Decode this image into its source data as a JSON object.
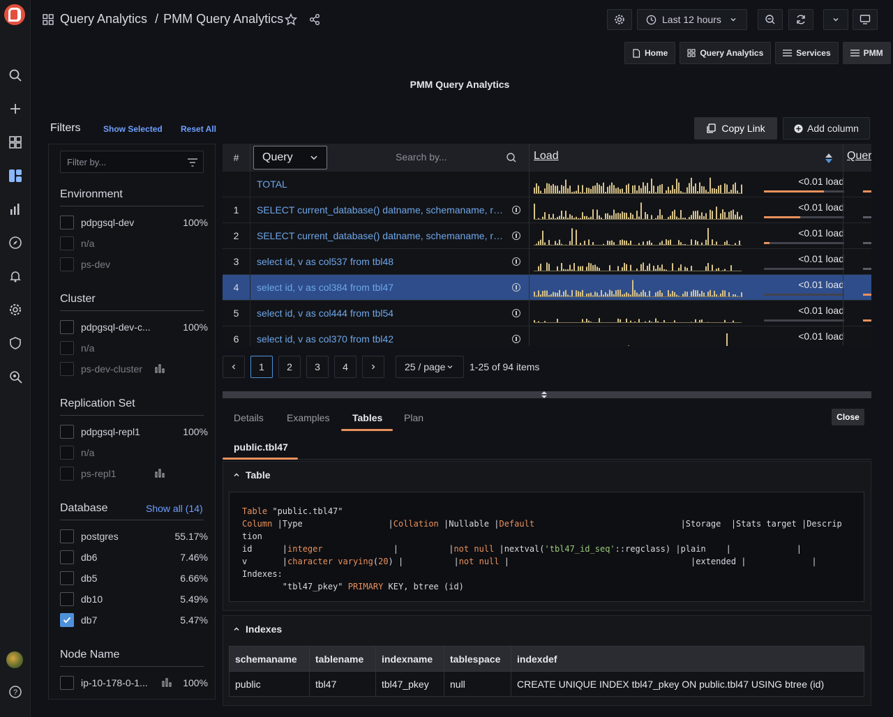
{
  "header": {
    "breadcrumb_root": "Query Analytics",
    "breadcrumb_sep": "/",
    "breadcrumb_page": "PMM Query Analytics",
    "time_range": "Last 12 hours"
  },
  "links": [
    "Home",
    "Query Analytics",
    "Services",
    "PMM"
  ],
  "panel_title": "PMM Query Analytics",
  "filters": {
    "title": "Filters",
    "show_selected": "Show Selected",
    "reset_all": "Reset All",
    "search_placeholder": "Filter by...",
    "show_all": "Show all (14)",
    "groups": [
      {
        "title": "Environment",
        "items": [
          {
            "label": "pdpgsql-dev",
            "pct": "100%",
            "checked": false,
            "dim": false
          },
          {
            "label": "n/a",
            "pct": "",
            "checked": false,
            "dim": true
          },
          {
            "label": "ps-dev",
            "pct": "",
            "checked": false,
            "dim": true
          }
        ]
      },
      {
        "title": "Cluster",
        "items": [
          {
            "label": "pdpgsql-dev-c...",
            "pct": "100%",
            "checked": false,
            "dim": false
          },
          {
            "label": "n/a",
            "pct": "",
            "checked": false,
            "dim": true
          },
          {
            "label": "ps-dev-cluster",
            "pct": "",
            "checked": false,
            "dim": true
          }
        ]
      },
      {
        "title": "Replication Set",
        "items": [
          {
            "label": "pdpgsql-repl1",
            "pct": "100%",
            "checked": false,
            "dim": false
          },
          {
            "label": "n/a",
            "pct": "",
            "checked": false,
            "dim": true
          },
          {
            "label": "ps-repl1",
            "pct": "",
            "checked": false,
            "dim": true
          }
        ]
      },
      {
        "title": "Database",
        "items": [
          {
            "label": "postgres",
            "pct": "55.17%",
            "checked": false,
            "dim": false
          },
          {
            "label": "db6",
            "pct": "7.46%",
            "checked": false,
            "dim": false
          },
          {
            "label": "db5",
            "pct": "6.66%",
            "checked": false,
            "dim": false
          },
          {
            "label": "db10",
            "pct": "5.49%",
            "checked": false,
            "dim": false
          },
          {
            "label": "db7",
            "pct": "5.47%",
            "checked": true,
            "dim": false
          }
        ]
      },
      {
        "title": "Node Name",
        "items": [
          {
            "label": "ip-10-178-0-1...",
            "pct": "100%",
            "checked": false,
            "dim": false
          }
        ]
      }
    ]
  },
  "actions": {
    "copy_link": "Copy Link",
    "add_column": "Add column"
  },
  "table": {
    "col_hash": "#",
    "col_query": "Query",
    "search_placeholder": "Search by...",
    "col_load": "Load",
    "col_next": "Quer",
    "selected_index": 4,
    "rows": [
      {
        "num": "",
        "query": "TOTAL",
        "load": "<0.01 load",
        "bar": 0.75
      },
      {
        "num": "1",
        "query": "SELECT current_database() datname, schemaname, rel...",
        "load": "<0.01 load",
        "bar": 0.45
      },
      {
        "num": "2",
        "query": "SELECT current_database() datname, schemaname, rel...",
        "load": "<0.01 load",
        "bar": 0.07
      },
      {
        "num": "3",
        "query": "select id, v as col537 from tbl48",
        "load": "<0.01 load",
        "bar": 0.0
      },
      {
        "num": "4",
        "query": "select id, v as col384 from tbl47",
        "load": "<0.01 load",
        "bar": 0.0
      },
      {
        "num": "5",
        "query": "select id, v as col444 from tbl54",
        "load": "<0.01 load",
        "bar": 0.0
      },
      {
        "num": "6",
        "query": "select id, v as col370 from tbl42",
        "load": "<0.01 load",
        "bar": 0.0
      }
    ]
  },
  "pagination": {
    "pages": [
      "1",
      "2",
      "3",
      "4"
    ],
    "current": "1",
    "page_size": "25 / page",
    "summary": "1-25 of 94 items"
  },
  "details": {
    "tabs": [
      "Details",
      "Examples",
      "Tables",
      "Plan"
    ],
    "active_tab": "Tables",
    "close": "Close",
    "subtab": "public.tbl47",
    "table_section": "Table",
    "indexes_section": "Indexes",
    "indexes_table": {
      "headers": [
        "schemaname",
        "tablename",
        "indexname",
        "tablespace",
        "indexdef"
      ],
      "rows": [
        [
          "public",
          "tbl47",
          "tbl47_pkey",
          "null",
          "CREATE UNIQUE INDEX tbl47_pkey ON public.tbl47 USING btree (id)"
        ]
      ]
    }
  },
  "colors": {
    "accent": "#e8915d",
    "link": "#6e9fff",
    "selected_row": "#2e4d8a",
    "spark": "#d8c38a"
  }
}
